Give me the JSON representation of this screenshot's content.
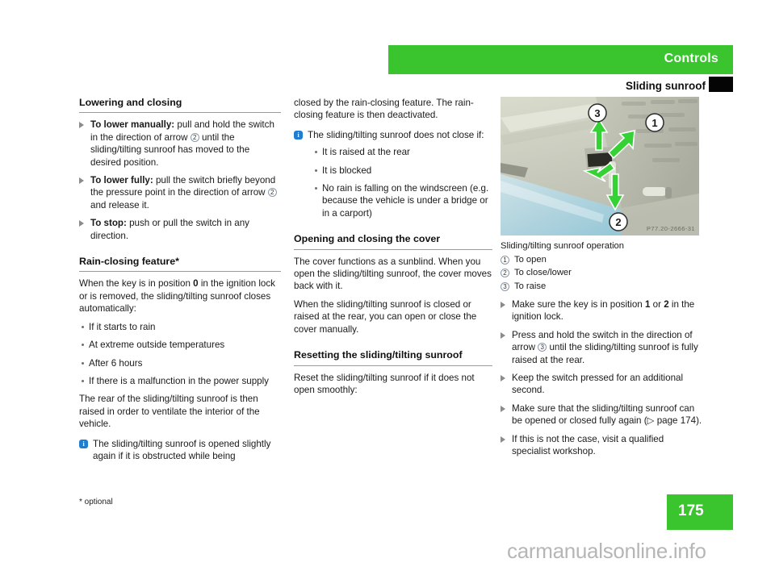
{
  "header": {
    "chapter": "Controls",
    "section": "Sliding sunroof"
  },
  "col1": {
    "heading": "Lowering and closing",
    "items": [
      {
        "lead": "To lower manually:",
        "text_a": " pull and hold the switch in the direction of arrow ",
        "circle": "2",
        "text_b": " until the sliding/tilting sunroof has moved to the desired position."
      },
      {
        "lead": "To lower fully:",
        "text_a": " pull the switch briefly beyond the pressure point in the direction of arrow ",
        "circle": "2",
        "text_b": " and release it."
      },
      {
        "lead": "To stop:",
        "text_a": " push or pull the switch in any direction.",
        "circle": "",
        "text_b": ""
      }
    ],
    "heading2": "Rain-closing feature*",
    "para1_a": "When the key is in position ",
    "para1_bold": "0",
    "para1_b": " in the ignition lock or is removed, the sliding/tilting sunroof closes automatically:",
    "bullets": [
      "If it starts to rain",
      "At extreme outside temperatures",
      "After 6 hours",
      "If there is a malfunction in the power supply"
    ],
    "para2": "The rear of the sliding/tilting sunroof is then raised in order to ventilate the interior of the vehicle.",
    "note": "The sliding/tilting sunroof is opened slightly again if it is obstructed while being",
    "info_icon": "i"
  },
  "col2": {
    "cont_para": "closed by the rain-closing feature. The rain-closing feature is then deactivated.",
    "note": "The sliding/tilting sunroof does not close if:",
    "info_icon": "i",
    "note_bullets": [
      "It is raised at the rear",
      "It is blocked",
      "No rain is falling on the windscreen (e.g. because the vehicle is under a bridge or in a carport)"
    ],
    "heading": "Opening and closing the cover",
    "para1": "The cover functions as a sunblind. When you open the sliding/tilting sunroof, the cover moves back with it.",
    "para2": "When the sliding/tilting sunroof is closed or raised at the rear, you can open or close the cover manually.",
    "heading2": "Resetting the sliding/tilting sunroof",
    "para3": "Reset the sliding/tilting sunroof if it does not open smoothly:"
  },
  "col3": {
    "photo_code": "P77.20-2666-31",
    "photo_labels": [
      "1",
      "2",
      "3"
    ],
    "legend_caption": "Sliding/tilting sunroof operation",
    "legend": [
      {
        "num": "1",
        "text": "To open"
      },
      {
        "num": "2",
        "text": "To close/lower"
      },
      {
        "num": "3",
        "text": "To raise"
      }
    ],
    "items": [
      {
        "text_a": "Make sure the key is in position ",
        "bold_a": "1",
        "text_mid": " or ",
        "bold_b": "2",
        "text_b": " in the ignition lock."
      },
      {
        "text_a": "Press and hold the switch in the direction of arrow ",
        "circle": "3",
        "text_b": " until the sliding/tilting sunroof is fully raised at the rear."
      },
      {
        "text_a": "Keep the switch pressed for an additional second.",
        "circle": "",
        "text_b": ""
      },
      {
        "text_a": "Make sure that the sliding/tilting sunroof can be opened or closed fully again (▷ page 174).",
        "circle": "",
        "text_b": ""
      },
      {
        "text_a": "If this is not the case, visit a qualified specialist workshop.",
        "circle": "",
        "text_b": ""
      }
    ]
  },
  "footer": {
    "footnote": "* optional",
    "page_number": "175",
    "watermark": "carmanualsonline.info"
  },
  "colors": {
    "brand_green": "#3ac42e",
    "info_blue": "#1f7ed0",
    "rule_gray": "#9a9a9a"
  }
}
